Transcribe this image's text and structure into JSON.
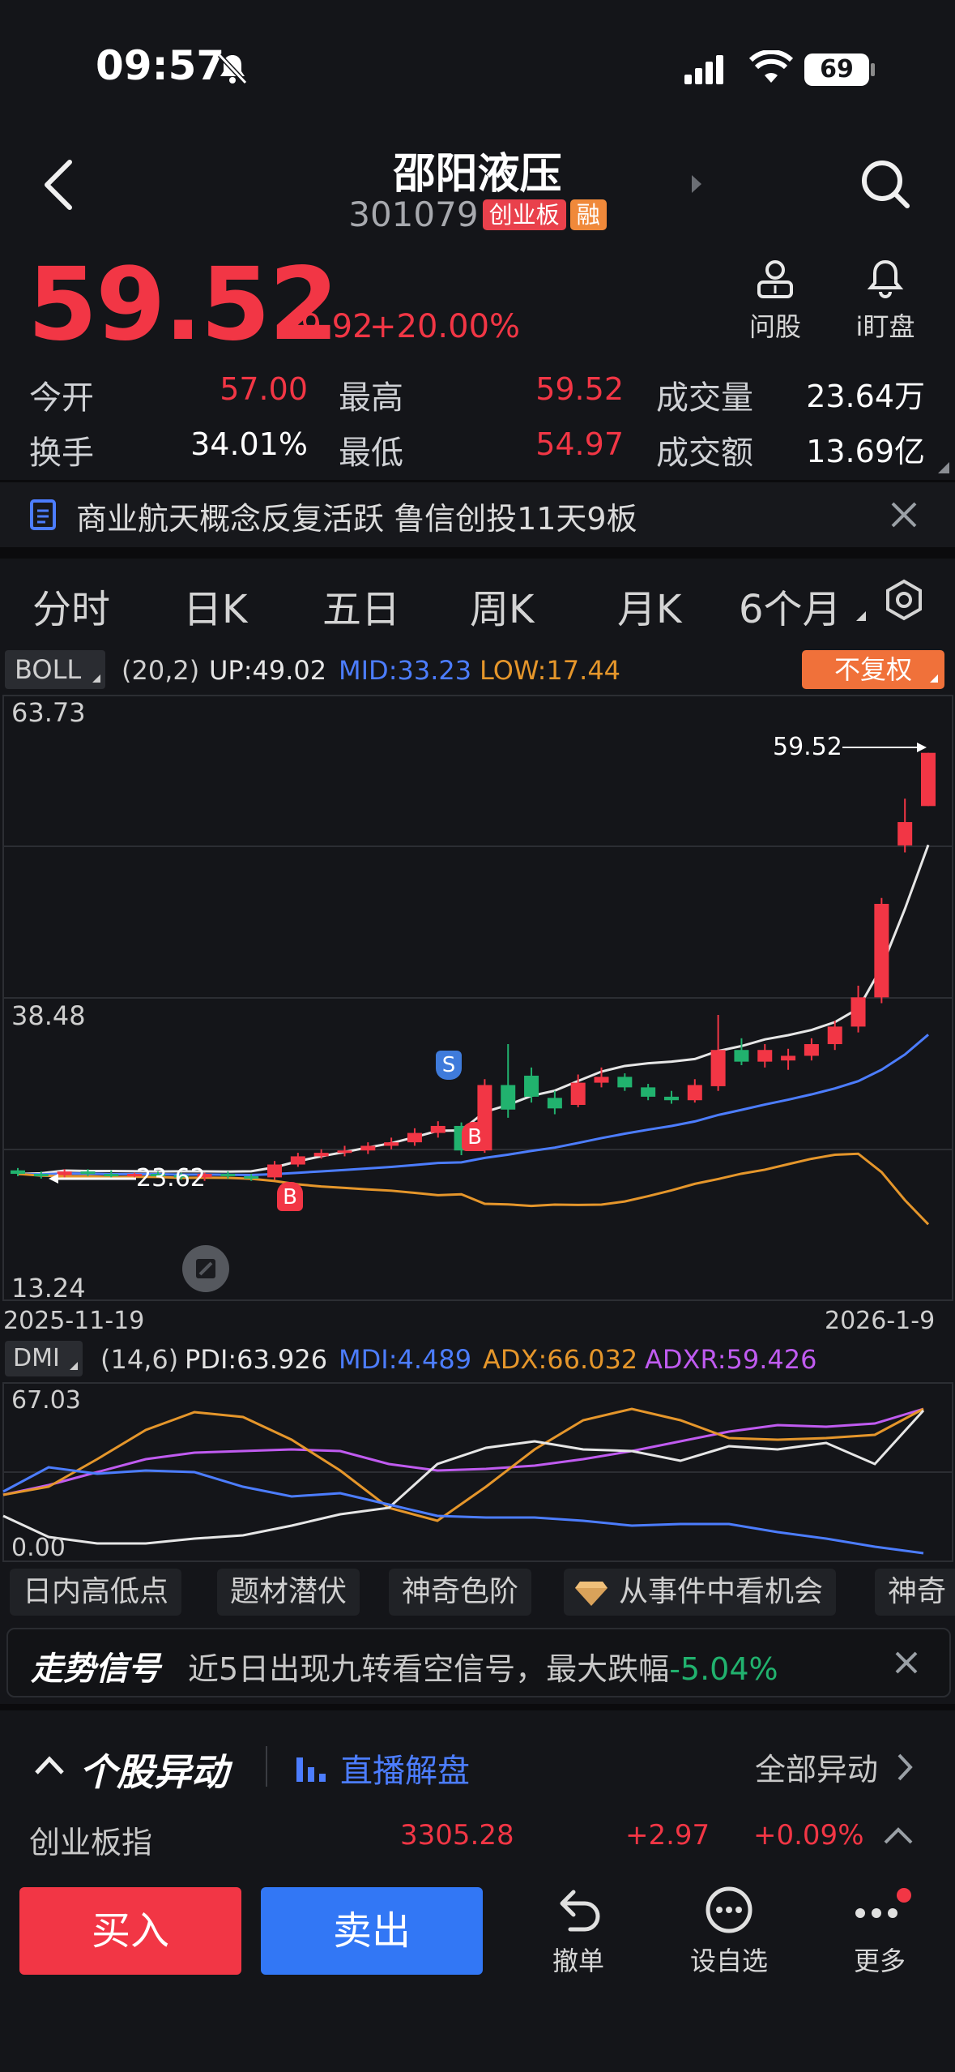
{
  "status_bar": {
    "time": "09:57",
    "battery": "69"
  },
  "header": {
    "name": "邵阳液压",
    "code": "301079",
    "tag_board": "创业板",
    "tag_margin": "融"
  },
  "quote": {
    "price": "59.52",
    "change": "+9.92",
    "pct": "+20.00%",
    "ask_label": "问股",
    "watch_label": "i盯盘",
    "stats": [
      {
        "label": "今开",
        "value": "57.00"
      },
      {
        "label": "最高",
        "value": "59.52"
      },
      {
        "label": "成交量",
        "value": "23.64万"
      },
      {
        "label": "换手",
        "value": "34.01%"
      },
      {
        "label": "最低",
        "value": "54.97"
      },
      {
        "label": "成交额",
        "value": "13.69亿"
      }
    ]
  },
  "news": {
    "text": "商业航天概念反复活跃 鲁信创投11天9板"
  },
  "tabs": [
    "分时",
    "日K",
    "五日",
    "周K",
    "月K",
    "6个月"
  ],
  "boll": {
    "name": "BOLL",
    "params": "(20,2)",
    "up": "UP:49.02",
    "mid": "MID:33.23",
    "low": "LOW:17.44",
    "adjust": "不复权"
  },
  "price_axis": {
    "top": "63.73",
    "mid": "38.48",
    "bottom": "13.24",
    "last": "59.52",
    "low_mark": "23.62",
    "start_date": "2025-11-19",
    "end_date": "2026-1-9"
  },
  "markers": {
    "s": "S",
    "b": "B"
  },
  "dmi": {
    "name": "DMI",
    "params": "(14,6)",
    "pdi": "PDI:63.926",
    "mdi": "MDI:4.489",
    "adx": "ADX:66.032",
    "adxr": "ADXR:59.426",
    "top": "67.03",
    "bottom": "0.00"
  },
  "chips": [
    "日内高低点",
    "题材潜伏",
    "神奇色阶",
    "从事件中看机会",
    "神奇"
  ],
  "signal": {
    "title": "走势信号",
    "text": "近5日出现九转看空信号，最大跌幅",
    "value": "-5.04%"
  },
  "alerts": {
    "title": "个股异动",
    "live": "直播解盘",
    "all": "全部异动"
  },
  "index": {
    "name": "创业板指",
    "value": "3305.28",
    "change": "+2.97",
    "pct": "+0.09%"
  },
  "bottom_bar": {
    "buy": "买入",
    "sell": "卖出",
    "cancel": "撤单",
    "watchlist": "设自选",
    "more": "更多"
  },
  "colors": {
    "up": "#f23645",
    "down": "#21b26e",
    "blue": "#4c7dff",
    "orange": "#e5962b",
    "purple": "#c05bf0",
    "bg": "#141519"
  },
  "chart_data": [
    {
      "type": "candlestick",
      "indicator": "BOLL",
      "y_range": [
        13.24,
        63.73
      ],
      "ohlc": [
        [
          23.8,
          24.0,
          23.3,
          23.5
        ],
        [
          23.5,
          23.7,
          23.1,
          23.4
        ],
        [
          23.4,
          23.9,
          23.2,
          23.7
        ],
        [
          23.7,
          23.9,
          23.3,
          23.5
        ],
        [
          23.5,
          23.8,
          23.2,
          23.3
        ],
        [
          23.3,
          23.6,
          23.1,
          23.5
        ],
        [
          23.5,
          23.7,
          23.2,
          23.4
        ],
        [
          23.4,
          23.6,
          23.0,
          23.2
        ],
        [
          23.2,
          23.6,
          22.9,
          23.5
        ],
        [
          23.5,
          23.7,
          23.1,
          23.3
        ],
        [
          23.3,
          23.5,
          22.9,
          23.1
        ],
        [
          23.2,
          24.6,
          23.0,
          24.3
        ],
        [
          24.3,
          25.3,
          24.1,
          25.0
        ],
        [
          25.0,
          25.6,
          24.8,
          25.3
        ],
        [
          25.3,
          25.9,
          25.0,
          25.5
        ],
        [
          25.5,
          26.2,
          25.2,
          25.9
        ],
        [
          25.9,
          26.6,
          25.6,
          26.2
        ],
        [
          26.2,
          27.4,
          25.9,
          27.0
        ],
        [
          27.0,
          28.0,
          26.6,
          27.6
        ],
        [
          27.6,
          27.9,
          25.1,
          25.5
        ],
        [
          25.5,
          31.6,
          25.3,
          31.1
        ],
        [
          31.1,
          34.6,
          28.3,
          29.0
        ],
        [
          31.9,
          32.6,
          29.6,
          30.1
        ],
        [
          30.0,
          30.6,
          28.6,
          29.1
        ],
        [
          29.4,
          32.0,
          29.2,
          31.3
        ],
        [
          31.3,
          32.6,
          30.9,
          31.8
        ],
        [
          31.8,
          32.1,
          30.6,
          30.9
        ],
        [
          30.9,
          31.2,
          29.8,
          30.1
        ],
        [
          30.1,
          30.6,
          29.5,
          29.8
        ],
        [
          29.8,
          31.6,
          29.6,
          31.1
        ],
        [
          31.0,
          37.1,
          30.6,
          34.1
        ],
        [
          34.1,
          35.1,
          32.8,
          33.1
        ],
        [
          33.1,
          34.6,
          32.6,
          34.1
        ],
        [
          33.2,
          34.2,
          32.4,
          33.6
        ],
        [
          33.6,
          35.1,
          33.2,
          34.6
        ],
        [
          34.6,
          36.6,
          34.1,
          36.1
        ],
        [
          36.1,
          39.6,
          35.6,
          38.6
        ],
        [
          38.6,
          47.1,
          38.1,
          46.6
        ],
        [
          51.6,
          55.6,
          51.0,
          53.6
        ],
        [
          54.97,
          59.52,
          54.97,
          59.52
        ]
      ],
      "boll_up_last": 49.02,
      "boll_mid_last": 33.23,
      "boll_low_last": 17.44,
      "last": 59.52
    },
    {
      "type": "line",
      "indicator": "DMI",
      "y_range": [
        0,
        67.03
      ],
      "series": [
        {
          "name": "PDI",
          "last": 63.926
        },
        {
          "name": "MDI",
          "last": 4.489
        },
        {
          "name": "ADX",
          "last": 66.032
        },
        {
          "name": "ADXR",
          "last": 59.426
        }
      ]
    }
  ]
}
